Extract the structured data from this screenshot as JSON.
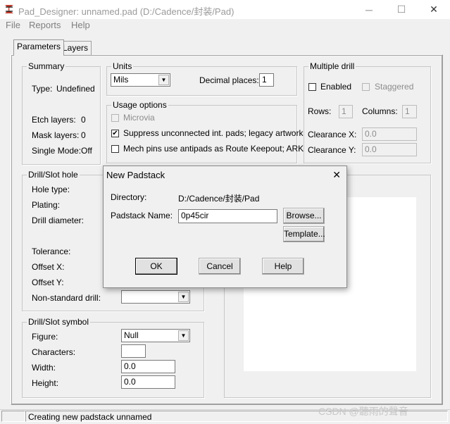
{
  "window": {
    "title": "Pad_Designer: unnamed.pad (D:/Cadence/封装/Pad)",
    "min_glyph": "─",
    "max_glyph": "☐",
    "close_glyph": "✕",
    "icon": "pad-designer-logo-icon"
  },
  "menu": {
    "items": [
      "File",
      "Reports",
      "Help"
    ]
  },
  "tabs": [
    {
      "label": "Parameters",
      "active": true
    },
    {
      "label": "Layers",
      "active": false
    }
  ],
  "summary": {
    "legend": "Summary",
    "type_label": "Type:",
    "type_value": "Undefined",
    "etch_label": "Etch layers:",
    "etch_value": "0",
    "mask_label": "Mask layers:",
    "mask_value": "0",
    "single_label": "Single Mode:",
    "single_value": "Off"
  },
  "units": {
    "legend": "Units",
    "value": "Mils",
    "decimal_label": "Decimal places:",
    "decimal_value": "1"
  },
  "usage": {
    "legend": "Usage options",
    "microvia": "Microvia",
    "suppress": "Suppress unconnected int. pads; legacy artwork",
    "mech": "Mech pins use antipads as Route Keepout; ARK"
  },
  "multiple_drill": {
    "legend": "Multiple drill",
    "enabled": "Enabled",
    "staggered": "Staggered",
    "rows_label": "Rows:",
    "rows_value": "1",
    "columns_label": "Columns:",
    "columns_value": "1",
    "clearx_label": "Clearance X:",
    "clearx_value": "0.0",
    "cleary_label": "Clearance Y:",
    "cleary_value": "0.0"
  },
  "drill": {
    "legend": "Drill/Slot hole",
    "hole_type": "Hole type:",
    "plating": "Plating:",
    "diameter": "Drill diameter:",
    "tolerance": "Tolerance:",
    "offset_x": "Offset X:",
    "offset_y": "Offset Y:",
    "nonstd": "Non-standard drill:",
    "nonstd_value": ""
  },
  "drill_symbol": {
    "legend": "Drill/Slot symbol",
    "figure_label": "Figure:",
    "figure_value": "Null",
    "characters_label": "Characters:",
    "characters_value": "",
    "width_label": "Width:",
    "width_value": "0.0",
    "height_label": "Height:",
    "height_value": "0.0"
  },
  "status": {
    "text": "Creating new padstack unnamed"
  },
  "dialog": {
    "title": "New Padstack",
    "close_glyph": "✕",
    "directory_label": "Directory:",
    "directory_value": "D:/Cadence/封装/Pad",
    "name_label": "Padstack Name:",
    "name_value": "0p45cir",
    "browse": "Browse...",
    "template": "Template...",
    "ok": "OK",
    "cancel": "Cancel",
    "help": "Help"
  },
  "watermark": "CSDN @聽雨的聲音",
  "arrow_glyph": "▼",
  "check_glyph": "✔"
}
